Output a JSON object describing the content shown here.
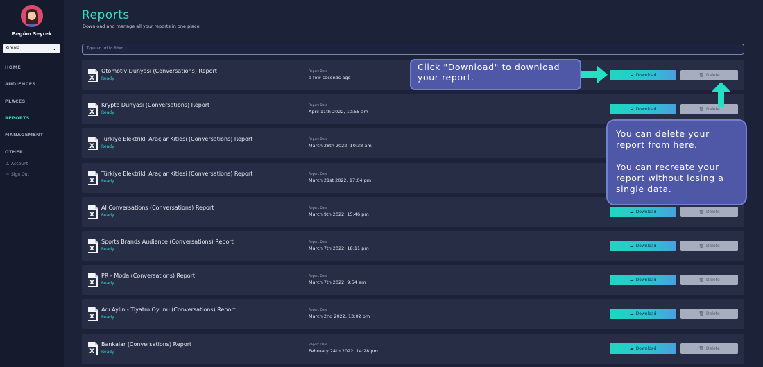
{
  "user": {
    "name": "Begüm Seyrek"
  },
  "org_select": {
    "value": "Kimola"
  },
  "nav": {
    "items": [
      "HOME",
      "AUDIENCES",
      "PLACES",
      "REPORTS",
      "MANAGEMENT",
      "OTHER"
    ],
    "active": "REPORTS",
    "sub": [
      {
        "icon": "person-icon",
        "label": "Account"
      },
      {
        "icon": "sign-out-icon",
        "label": "Sign Out"
      }
    ]
  },
  "header": {
    "title": "Reports",
    "subtitle": "Download and manage all your reports in one place."
  },
  "filter": {
    "placeholder": "Type an url to filter."
  },
  "row_labels": {
    "date_label": "Report Date",
    "download": "Download",
    "delete": "Delete"
  },
  "reports": [
    {
      "title": "Otomotiv Dünyası (Conversations) Report",
      "status": "Ready",
      "date": "a few seconds ago"
    },
    {
      "title": "Krypto Dünyası (Conversations) Report",
      "status": "Ready",
      "date": "April 11th 2022, 10:55 am"
    },
    {
      "title": "Türkiye Elektrikli Araçlar Kitlesi (Conversations) Report",
      "status": "Ready",
      "date": "March 28th 2022, 10:38 am"
    },
    {
      "title": "Türkiye Elektrikli Araçlar Kitlesi (Conversations) Report",
      "status": "Ready",
      "date": "March 21st 2022, 17:04 pm"
    },
    {
      "title": "AI Conversations (Conversations) Report",
      "status": "Ready",
      "date": "March 9th 2022, 15:46 pm"
    },
    {
      "title": "Sports Brands Audience (Conversations) Report",
      "status": "Ready",
      "date": "March 7th 2022, 18:11 pm"
    },
    {
      "title": "PR - Moda (Conversations) Report",
      "status": "Ready",
      "date": "March 7th 2022, 9:54 am"
    },
    {
      "title": "Adı Aylin - Tiyatro Oyunu (Conversations) Report",
      "status": "Ready",
      "date": "March 2nd 2022, 13:02 pm"
    },
    {
      "title": "Bankalar (Conversations) Report",
      "status": "Ready",
      "date": "February 24th 2022, 14:28 pm"
    }
  ],
  "callouts": {
    "download": "Click \"Download\" to download your report.",
    "delete": "You can delete your report from here.\n\nYou can recreate your report without losing a single data."
  },
  "colors": {
    "accent": "#2fd6c0",
    "callout": "#4f57a7",
    "background": "#1c2238",
    "sidebar": "#151a2c"
  }
}
